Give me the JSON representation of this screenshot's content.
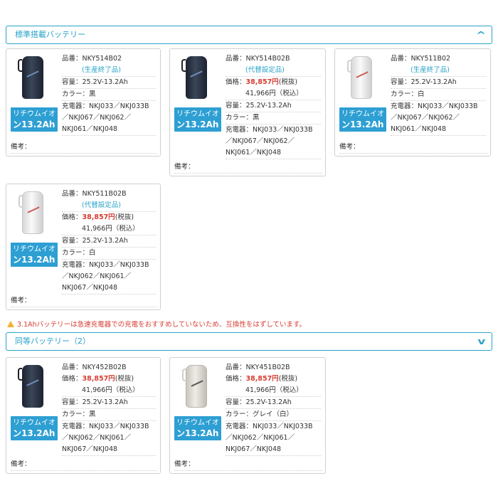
{
  "sections": {
    "standard": {
      "title": "標準搭載バッテリー"
    },
    "equivalent": {
      "title": "同等バッテリー（2）"
    }
  },
  "badge": {
    "line1": "リチウムイオ",
    "line2": "ン13.2Ah"
  },
  "labels": {
    "part": "品番：",
    "price": "価格：",
    "capacity": "容量：",
    "color": "カラー：",
    "charger": "充電器：",
    "remarks": "備考："
  },
  "cards": [
    {
      "part": "NKY514B02",
      "note": "(生産終了品)",
      "capacity": "25.2V-13.2Ah",
      "color": "黒",
      "charger_l1": "NKJ033／NKJ033B",
      "charger_l2": "／NKJ067／NKJ062／",
      "charger_l3": "NKJ061／NKJ048",
      "image": "black"
    },
    {
      "part": "NKY514B02B",
      "note": "(代替設定品)",
      "price": "38,857円",
      "price_suffix": "(税抜)",
      "price_tax": "41,966円（税込）",
      "capacity": "25.2V-13.2Ah",
      "color": "黒",
      "charger_l1": "NKJ033／NKJ033B",
      "charger_l2": "／NKJ067／NKJ062／",
      "charger_l3": "NKJ061／NKJ048",
      "image": "black"
    },
    {
      "part": "NKY511B02",
      "note": "(生産終了品)",
      "capacity": "25.2V-13.2Ah",
      "color": "白",
      "charger_l1": "NKJ033／NKJ033B",
      "charger_l2": "／NKJ067／NKJ062／",
      "charger_l3": "NKJ061／NKJ048",
      "image": "white"
    },
    {
      "part": "NKY511B02B",
      "note": "(代替設定品)",
      "price": "38,857円",
      "price_suffix": "(税抜)",
      "price_tax": "41,966円（税込）",
      "capacity": "25.2V-13.2Ah",
      "color": "白",
      "charger_l1": "NKJ033／NKJ033B",
      "charger_l2": "／NKJ062／NKJ061／",
      "charger_l3": "NKJ067／NKJ048",
      "image": "white"
    },
    {
      "part": "NKY452B02B",
      "price": "38,857円",
      "price_suffix": "(税抜)",
      "price_tax": "41,966円（税込）",
      "capacity": "25.2V-13.2Ah",
      "color": "黒",
      "charger_l1": "NKJ033／NKJ033B",
      "charger_l2": "／NKJ062／NKJ061／",
      "charger_l3": "NKJ067／NKJ048",
      "image": "black"
    },
    {
      "part": "NKY451B02B",
      "price": "38,857円",
      "price_suffix": "(税抜)",
      "price_tax": "41,966円（税込）",
      "capacity": "25.2V-13.2Ah",
      "color": "グレイ（白）",
      "charger_l1": "NKJ033／NKJ033B",
      "charger_l2": "／NKJ062／NKJ061／",
      "charger_l3": "NKJ067／NKJ048",
      "image": "grey"
    }
  ],
  "warning": "3.1Ahバッテリーは急速充電器での充電をおすすめしていないため、互換性をはずしています。",
  "colors": {
    "accent": "#2aa3c8",
    "price": "#d63c30",
    "badge": "#2d9fd3"
  }
}
